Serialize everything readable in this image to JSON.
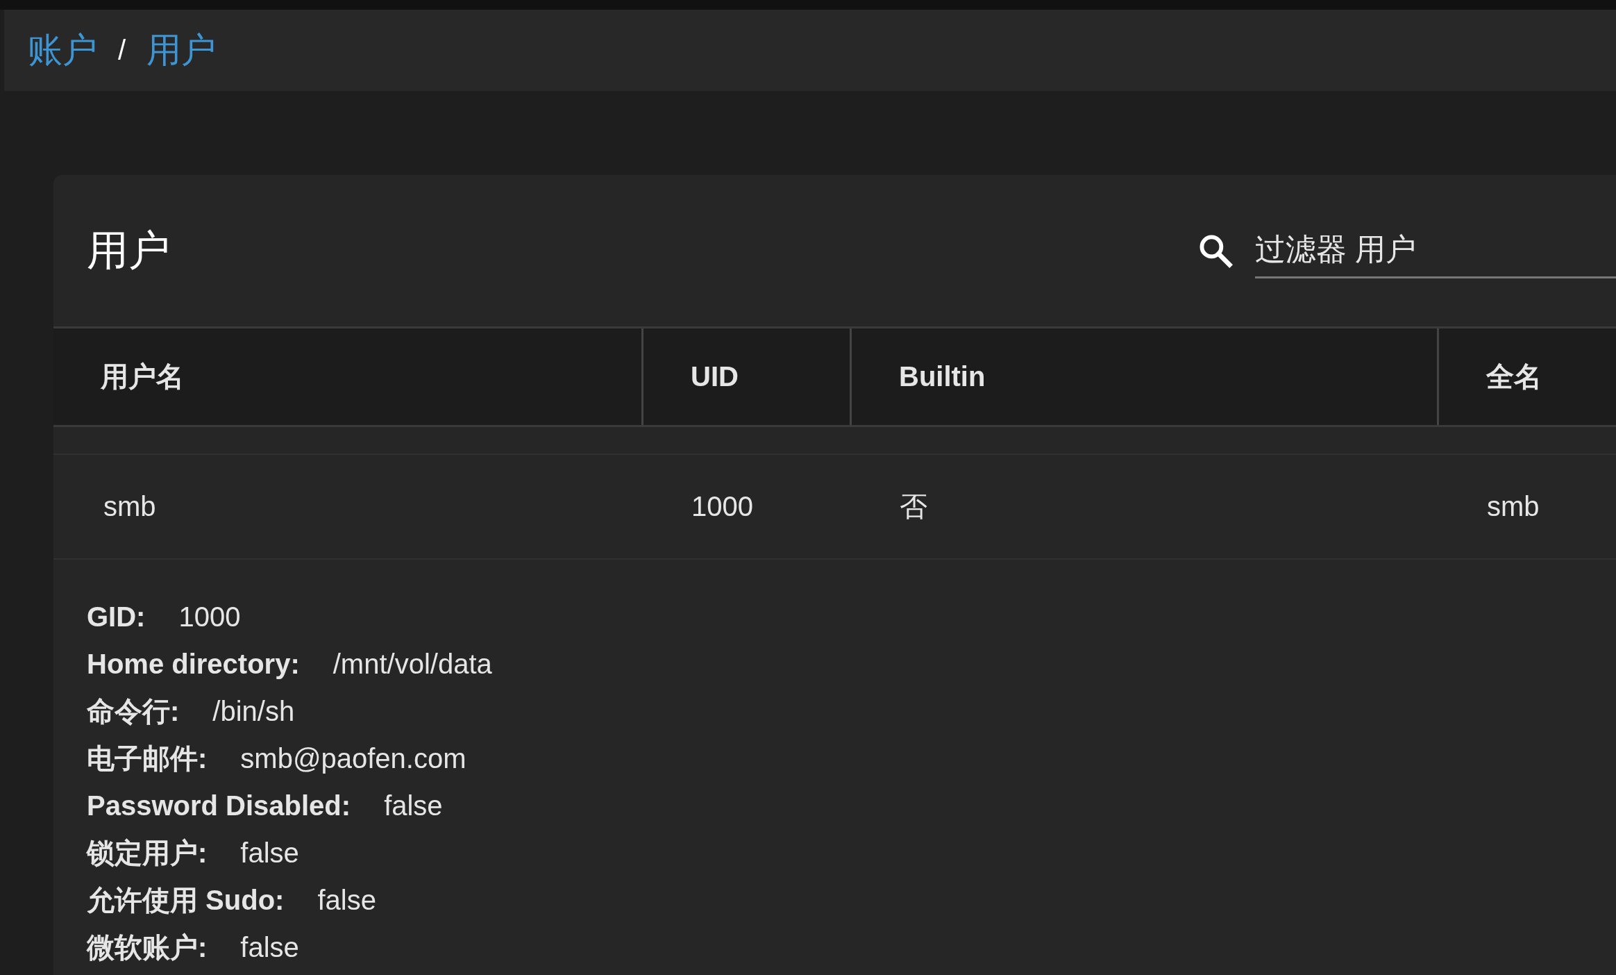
{
  "breadcrumb": {
    "items": [
      {
        "label": "账户"
      },
      {
        "label": "用户"
      }
    ],
    "separator": "/"
  },
  "card": {
    "title": "用户",
    "filter": {
      "placeholder": "过滤器 用户"
    }
  },
  "table": {
    "columns": [
      "用户名",
      "UID",
      "Builtin",
      "全名"
    ],
    "rows": [
      {
        "cells": [
          "smb",
          "1000",
          "否",
          "smb"
        ],
        "details": [
          {
            "label": "GID:",
            "value": "1000"
          },
          {
            "label": "Home directory:",
            "value": "/mnt/vol/data"
          },
          {
            "label": "命令行:",
            "value": "/bin/sh"
          },
          {
            "label": "电子邮件:",
            "value": "smb@paofen.com"
          },
          {
            "label": "Password Disabled:",
            "value": "false"
          },
          {
            "label": "锁定用户:",
            "value": "false"
          },
          {
            "label": "允许使用 Sudo:",
            "value": "false"
          },
          {
            "label": "微软账户:",
            "value": "false"
          }
        ]
      }
    ]
  }
}
